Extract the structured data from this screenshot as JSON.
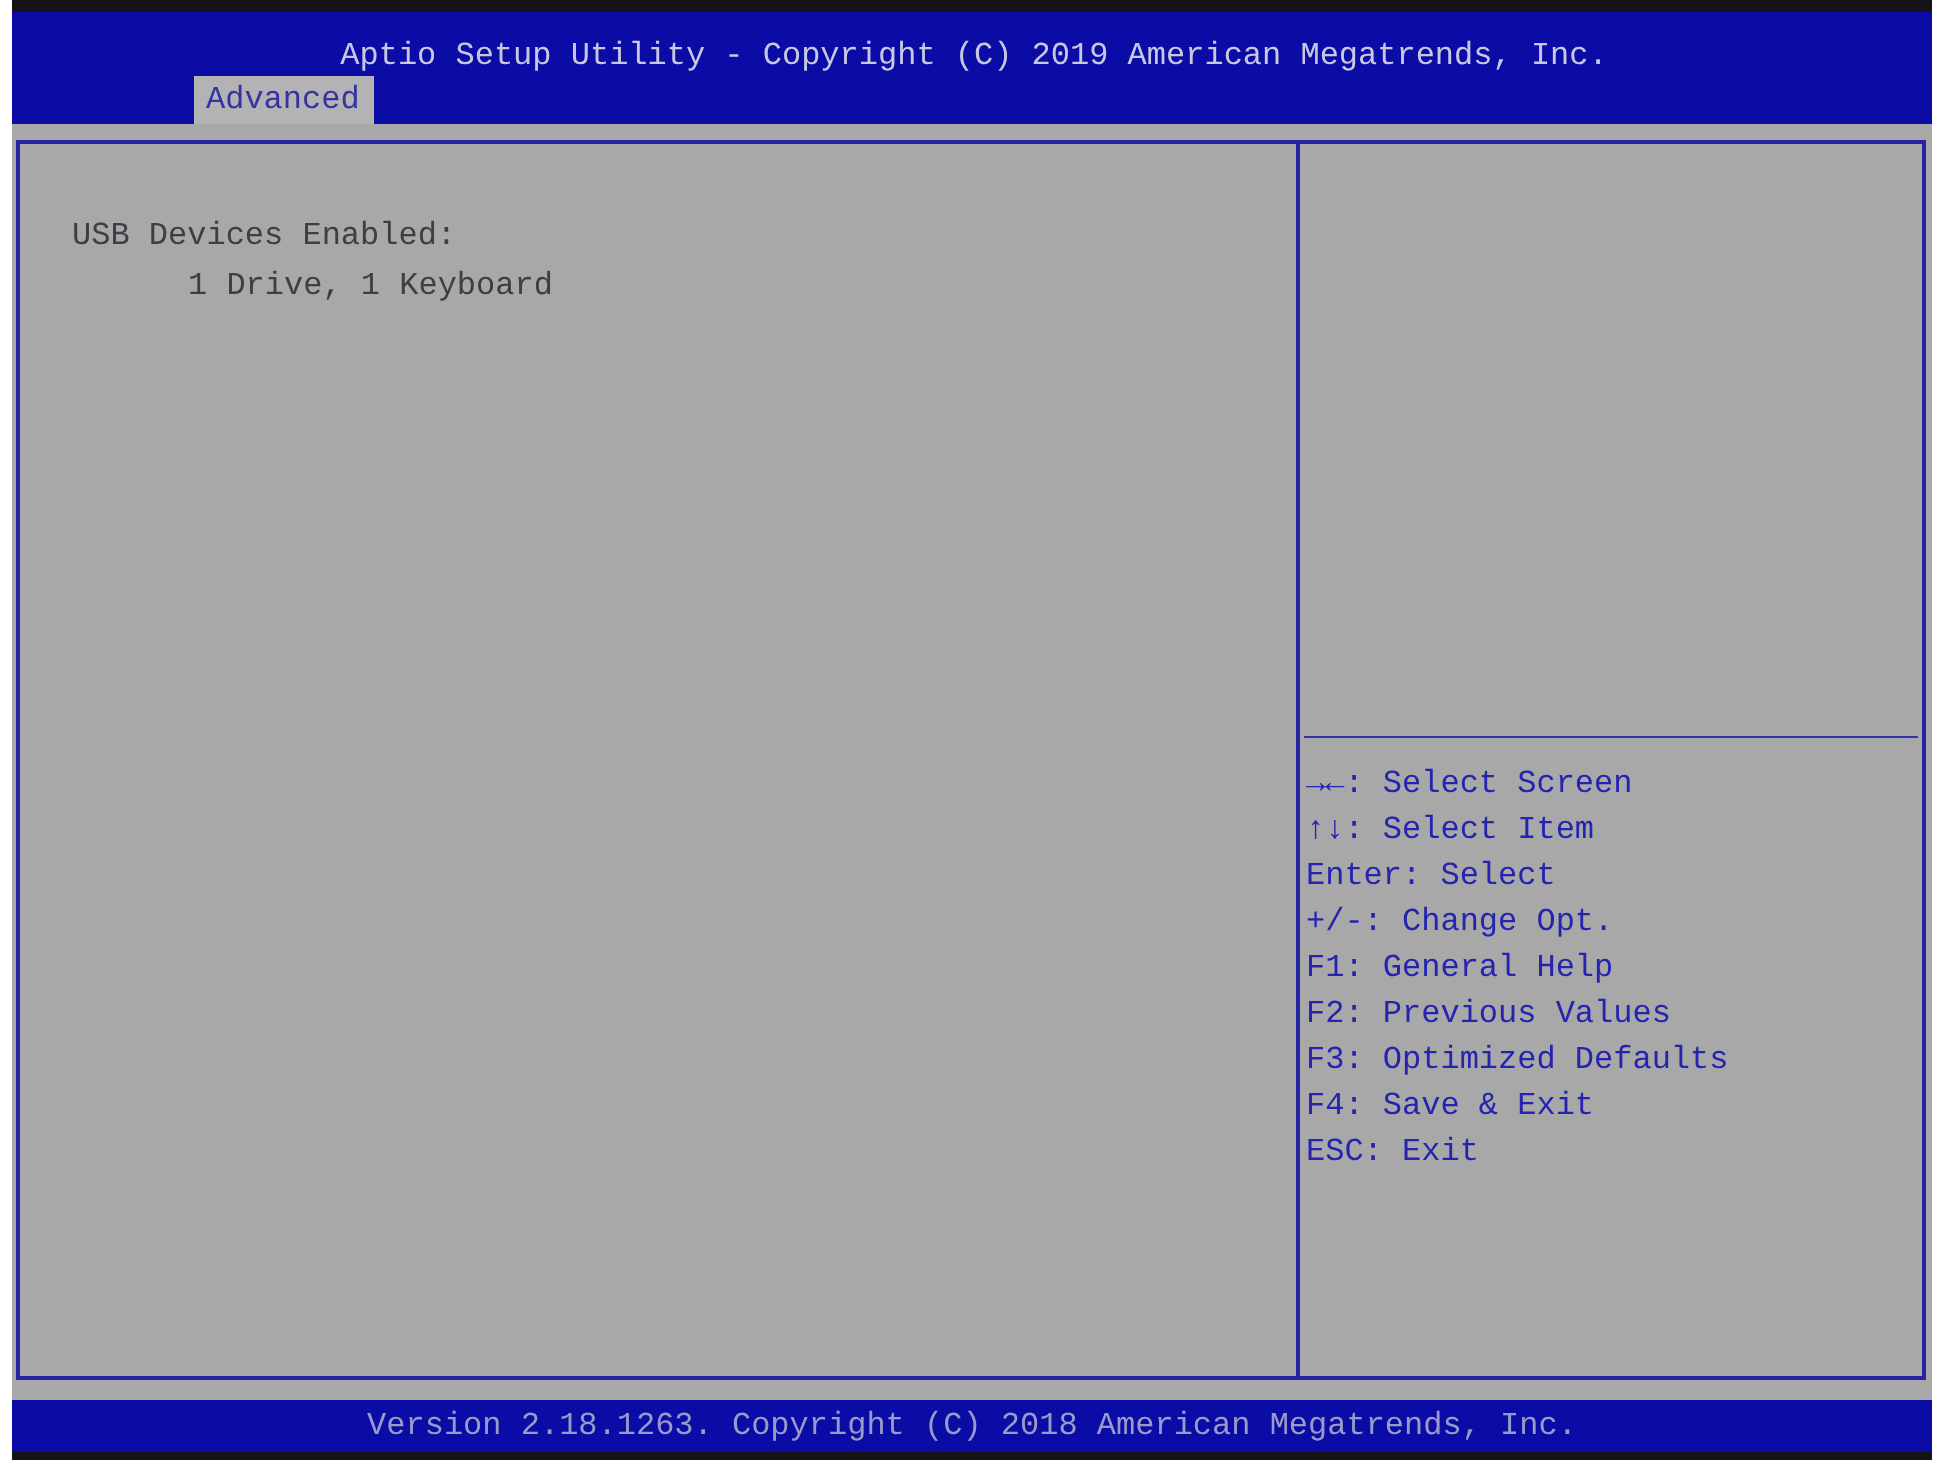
{
  "window": {
    "title": "Aptio Setup Utility - Copyright (C) 2019 American Megatrends, Inc."
  },
  "tabs": [
    {
      "label": "Advanced",
      "selected": true
    }
  ],
  "main_panel": {
    "items": [
      {
        "label": "USB Devices Enabled:",
        "value": "1 Drive, 1 Keyboard"
      }
    ]
  },
  "help_panel": {
    "keys": [
      "→←: Select Screen",
      "↑↓: Select Item",
      "Enter: Select",
      "+/-: Change Opt.",
      "F1: General Help",
      "F2: Previous Values",
      "F3: Optimized Defaults",
      "F4: Save & Exit",
      "ESC: Exit"
    ]
  },
  "status_bar": {
    "text": "Version 2.18.1263. Copyright (C) 2018 American Megatrends, Inc."
  }
}
